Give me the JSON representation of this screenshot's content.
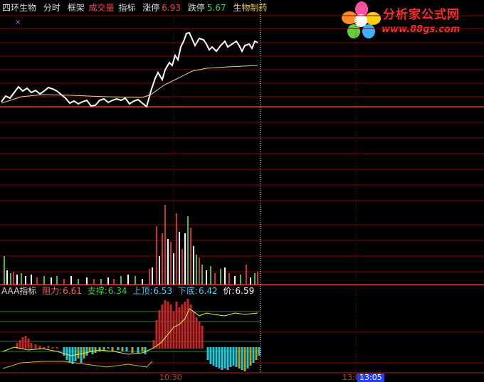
{
  "header": {
    "stock_name": "四环生物",
    "mode": "分时",
    "frame": "框架",
    "volume": "成交量",
    "indicator": "指标",
    "limit_up_label": "涨停",
    "limit_up_value": "6.93",
    "limit_down_label": "跌停",
    "limit_down_value": "5.67",
    "sector": "生物制药"
  },
  "indicator_bar": {
    "name": "AAA指标",
    "resistance_label": "阻力:",
    "resistance_value": "6.61",
    "support_label": "支撑:",
    "support_value": "6.34",
    "top_label": "上顶:",
    "top_value": "6.53",
    "bottom_label": "下底:",
    "bottom_value": "6.42",
    "price_label": "价:",
    "price_value": "6.59"
  },
  "logo": {
    "title": "分析家公式网",
    "url": "www.88gs.com"
  },
  "time_axis": {
    "t1": "10:30",
    "t2": "13:0",
    "cursor_time": "13:05"
  },
  "marker": "×",
  "colors": {
    "background": "#000000",
    "grid": "#8b0000",
    "price_line": "#ffffff",
    "avg_line": "#e6d88a",
    "volume_up": "#d03030",
    "volume_down": "#ffffff",
    "volume_green": "#40c040",
    "macd_pos": "#c02828",
    "macd_neg": "#20c8d8",
    "limit_up": "#ff4040",
    "limit_down": "#40d040",
    "indicator_text": "#40d0ff",
    "sector_text": "#f0d040"
  }
}
